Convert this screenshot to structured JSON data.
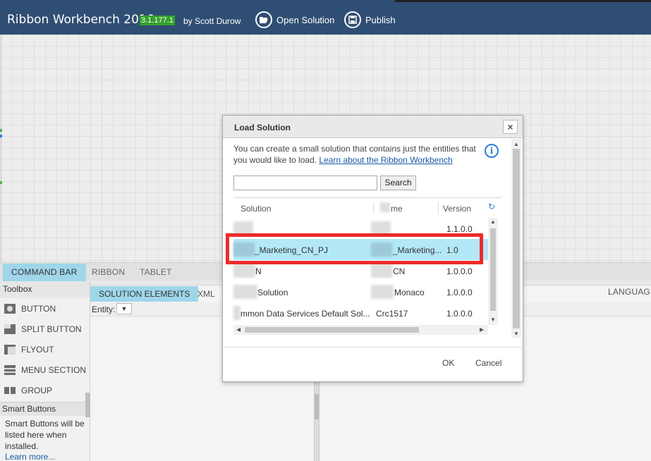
{
  "header": {
    "title": "Ribbon Workbench 2016",
    "version": "3.1.177.1",
    "author": "by Scott Durow",
    "open_solution": "Open Solution",
    "publish": "Publish"
  },
  "tabs": [
    "COMMAND BAR",
    "RIBBON",
    "TABLET"
  ],
  "toolbox": {
    "header": "Toolbox",
    "items": [
      "BUTTON",
      "SPLIT BUTTON",
      "FLYOUT",
      "MENU SECTION",
      "GROUP"
    ],
    "smart_header": "Smart Buttons",
    "smart_text": "Smart Buttons will be listed here when installed.",
    "smart_link": "Learn more..."
  },
  "solution_panel": {
    "tabs": [
      "SOLUTION ELEMENTS",
      "XML"
    ],
    "entity_label": "Entity:",
    "entity_select": "▼",
    "language": "LANGUAGE"
  },
  "dialog": {
    "title": "Load Solution",
    "close": "×",
    "description": "You can create a small solution that contains just the entities that you would like to load.",
    "learn_link": "Learn about the Ribbon Workbench",
    "search_placeholder": "",
    "search_button": "Search",
    "columns": [
      "Solution",
      "me",
      "Version"
    ],
    "rows": [
      {
        "solution": "",
        "name": "",
        "version": "1.1.0.0",
        "selected": false
      },
      {
        "solution": "_Marketing_CN_PJ",
        "name": "_Marketing...",
        "version": "1.0",
        "selected": true
      },
      {
        "solution": "N",
        "name": "CN",
        "version": "1.0.0.0",
        "selected": false
      },
      {
        "solution": "Solution",
        "name": "Monaco",
        "version": "1.0.0.0",
        "selected": false
      },
      {
        "solution": "mmon Data Services Default Sol...",
        "name": "Crc1517",
        "version": "1.0.0.0",
        "selected": false
      }
    ],
    "ok": "OK",
    "cancel": "Cancel"
  },
  "colors": {
    "header_bg": "#2f4e73",
    "version_badge": "#33a02c",
    "active_tab": "#9fd6ea",
    "selected_row": "#b3e8f7",
    "highlight": "#ee2b2b",
    "link": "#1a5aa6"
  }
}
